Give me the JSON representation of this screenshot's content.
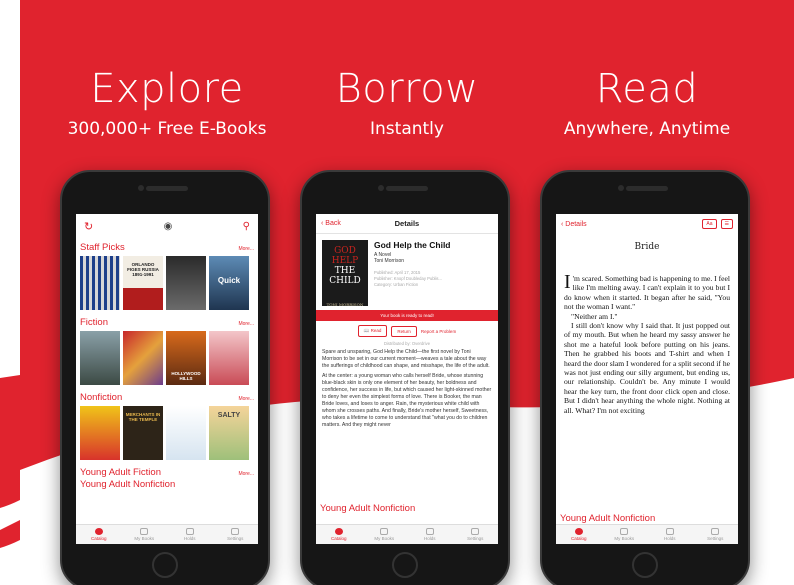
{
  "colors": {
    "brand_red": "#e0232e",
    "background": "#ffffff"
  },
  "panels": [
    {
      "title": "Explore",
      "subtitle": "300,000+ Free E-Books"
    },
    {
      "title": "Borrow",
      "subtitle": "Instantly"
    },
    {
      "title": "Read",
      "subtitle": "Anywhere, Anytime"
    }
  ],
  "tabs": [
    "Catalog",
    "My Books",
    "Holds",
    "Settings"
  ],
  "catalog": {
    "sections": [
      {
        "title": "Staff Picks",
        "more": "More...",
        "books": [
          "",
          "ORLANDO FIGES RUSSIA 1891-1991",
          "",
          "Quick"
        ]
      },
      {
        "title": "Fiction",
        "more": "More...",
        "books": [
          "",
          "",
          "",
          "HOLLYWOOD HILLS"
        ]
      },
      {
        "title": "Nonfiction",
        "more": "More...",
        "books": [
          "",
          "MERCHANTS IN THE TEMPLE",
          "",
          "SALTY"
        ]
      },
      {
        "title": "Young Adult Fiction",
        "more": "More..."
      },
      {
        "title": "Young Adult Nonfiction",
        "more": ""
      }
    ]
  },
  "details": {
    "back": "Back",
    "title": "Details",
    "cover_lines": [
      "GOD",
      "HELP",
      "THE",
      "CHILD"
    ],
    "cover_author": "TONI MORRISON",
    "book_title": "God Help the Child",
    "book_subtitle": "A Novel",
    "author": "Toni Morrison",
    "published": "Published: April 17, 2015",
    "publisher": "Publisher: Knopf Doubleday Publis...",
    "category": "Category: Urban Fiction",
    "ready": "Your book is ready to read!",
    "read": "Read",
    "return": "Return",
    "report": "Report a Problem",
    "distributed": "Distributed by: Overdrive",
    "description": [
      "Spare and unsparing, God Help the Child—the first novel by Toni Morrison to be set in our current moment—weaves a tale about the way the sufferings of childhood can shape, and misshape, the life of the adult.",
      "At the center: a young woman who calls herself Bride, whose stunning blue-black skin is only one element of her beauty, her boldness and confidence, her success in life, but which caused her light-skinned mother to deny her even the simplest forms of love. There is Booker, the man Bride loves, and loses to anger. Rain, the mysterious white child with whom she crosses paths. And finally, Bride's mother herself, Sweetness, who takes a lifetime to come to understand that \"what you do to children matters. And they might never"
    ],
    "bottom_section": "Young Adult Nonfiction"
  },
  "reader": {
    "back": "Details",
    "font_btn": "Aa",
    "toc_btn": "☰",
    "chapter": "Bride",
    "dropcap": "I",
    "paragraphs": [
      "'m scared. Something bad is happening to me. I feel like I'm melting away. I can't explain it to you but I do know when it started. It began after he said, \"You not the woman I want.\"",
      "\"Neither am I.\"",
      "I still don't know why I said that. It just popped out of my mouth. But when he heard my sassy answer he shot me a hateful look before putting on his jeans. Then he grabbed his boots and T-shirt and when I heard the door slam I wondered for a split second if he was not just ending our silly argument, but ending us, our relationship. Couldn't be. Any minute I would hear the key turn, the front door click open and close. But I didn't hear anything the whole night. Nothing at all. What? I'm not exciting"
    ],
    "bottom_section": "Young Adult Nonfiction"
  }
}
